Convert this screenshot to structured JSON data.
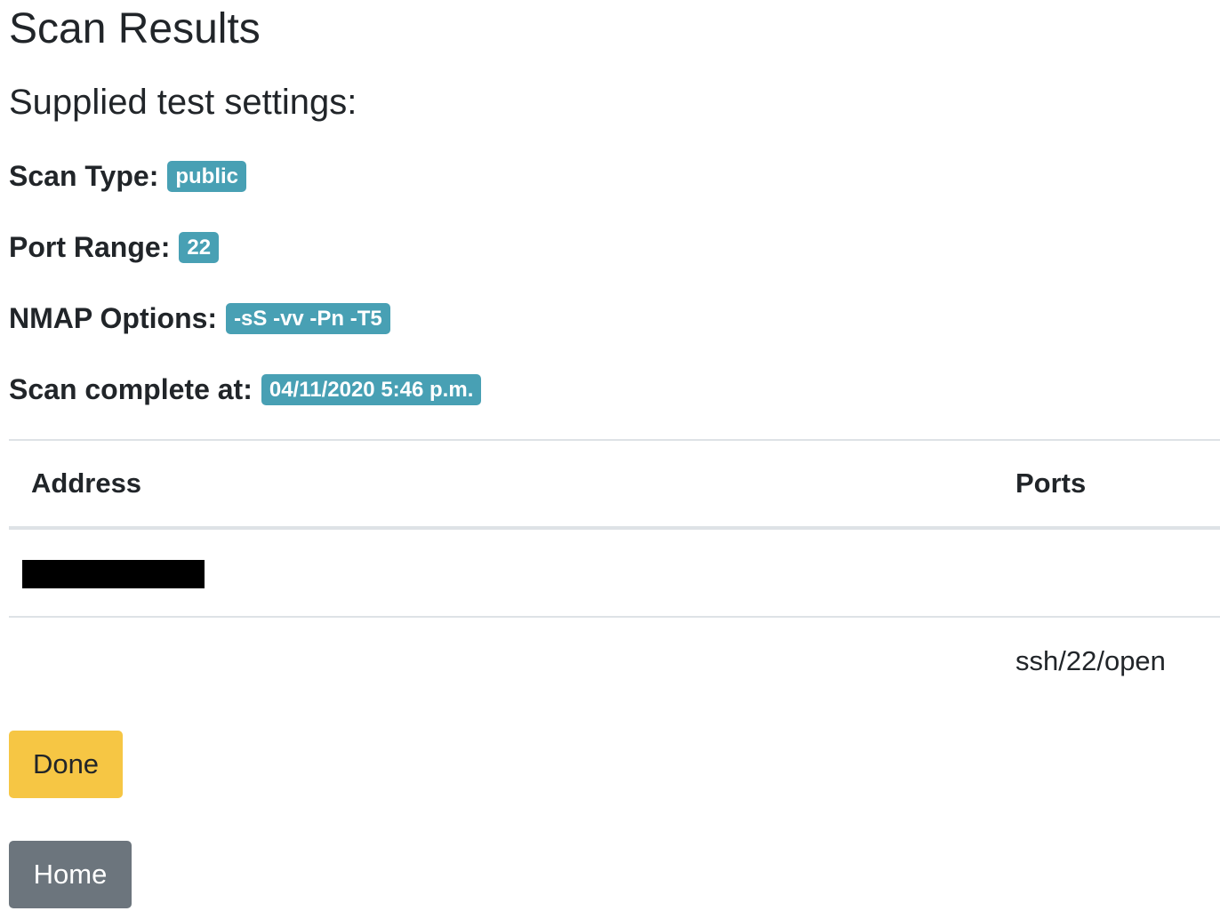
{
  "page": {
    "title": "Scan Results",
    "subtitle": "Supplied test settings:"
  },
  "settings": {
    "scan_type_label": "Scan Type:",
    "scan_type_value": "public",
    "port_range_label": "Port Range:",
    "port_range_value": "22",
    "nmap_options_label": "NMAP Options:",
    "nmap_options_value": "-sS -vv -Pn -T5",
    "scan_complete_label": "Scan complete at:",
    "scan_complete_value": "04/11/2020 5:46 p.m."
  },
  "table": {
    "headers": [
      "Address",
      "Ports"
    ],
    "rows": [
      {
        "address": "",
        "ports": ""
      },
      {
        "address": "",
        "ports": "ssh/22/open"
      }
    ]
  },
  "buttons": {
    "done_label": "Done",
    "home_label": "Home"
  },
  "colors": {
    "badge": "#48a0b4",
    "done_button": "#f6c644",
    "home_button": "#6c757d"
  }
}
